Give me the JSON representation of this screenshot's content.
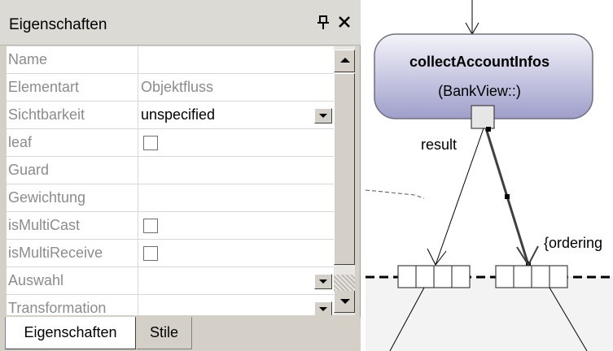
{
  "panel": {
    "title": "Eigenschaften",
    "pin_icon": "pin-icon",
    "close_icon": "close-icon"
  },
  "properties": [
    {
      "name": "Name",
      "value": ""
    },
    {
      "name": "Elementart",
      "value": "Objektfluss"
    },
    {
      "name": "Sichtbarkeit",
      "value": "unspecified"
    },
    {
      "name": "leaf",
      "value": ""
    },
    {
      "name": "Guard",
      "value": ""
    },
    {
      "name": "Gewichtung",
      "value": ""
    },
    {
      "name": "isMultiCast",
      "value": ""
    },
    {
      "name": "isMultiReceive",
      "value": ""
    },
    {
      "name": "Auswahl",
      "value": ""
    },
    {
      "name": "Transformation",
      "value": ""
    }
  ],
  "tabs": {
    "properties": "Eigenschaften",
    "styles": "Stile"
  },
  "diagram": {
    "action_name": "collectAccountInfos",
    "action_owner": "(BankView::)",
    "edge_label": "result",
    "ordering_label": "{ordering",
    "colors": {
      "node_top": "#f4f4fa",
      "node_bottom": "#9e9ecb",
      "node_border": "#6e6e7e",
      "selected_edge": "#404040"
    }
  }
}
